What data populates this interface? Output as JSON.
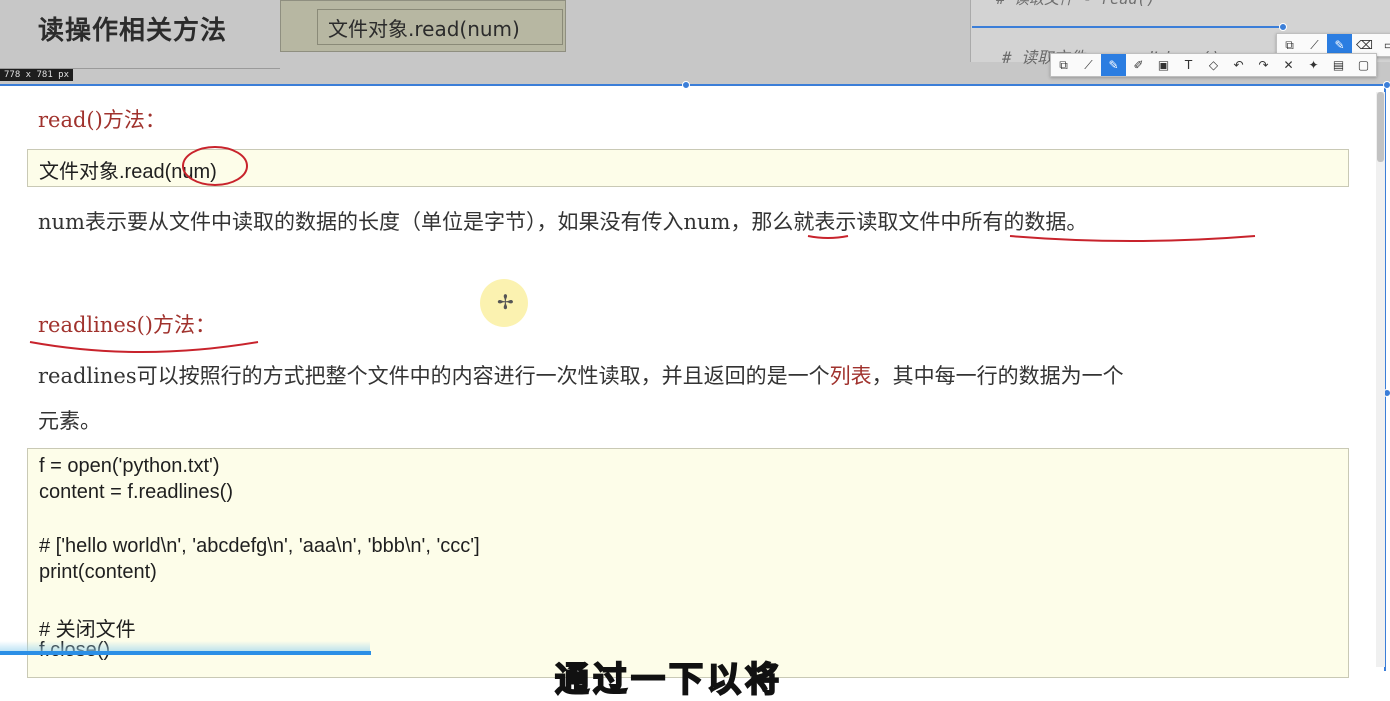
{
  "header": {
    "title": "读操作相关方法",
    "code_chip": "文件对象.read(num)",
    "dimension_label": "778 x 781  px"
  },
  "background_editor": {
    "top_line": "# 读取文件 - read()",
    "comment_line": "# 读取文件 - readLines()"
  },
  "toolbar_main": {
    "icons": [
      "screenshot-icon",
      "trend-icon",
      "pen-icon",
      "eraser-icon",
      "window-icon"
    ]
  },
  "toolbar_secondary": {
    "icons": [
      "copy-icon",
      "trend-icon",
      "pen-icon",
      "marker-icon",
      "fill-icon",
      "text-icon",
      "eraser-icon",
      "undo-icon",
      "redo-icon",
      "close-icon",
      "pin-icon",
      "save-icon",
      "clipboard-icon"
    ]
  },
  "doc": {
    "read_title": "read()方法：",
    "read_code": "文件对象.read(num)",
    "read_desc_part1": "num表示要从文件中读取的数据的长度（单位是字节），如果没有传入num，那么就表示读取文件中所有的数据。",
    "readlines_title": "readlines()方法：",
    "readlines_desc_pre": "readlines可以按照行的方式把整个文件中的内容进行一次性读取，并且返回的是一个",
    "readlines_desc_hl": "列表",
    "readlines_desc_post": "，其中每一行的数据为一个",
    "readlines_desc_line2": "元素。",
    "code_lines": [
      "f = open('python.txt')",
      "content = f.readlines()",
      "",
      "# ['hello world\\n', 'abcdefg\\n', 'aaa\\n', 'bbb\\n', 'ccc']",
      "print(content)",
      "",
      "# 关闭文件",
      "f.close()"
    ]
  },
  "colors": {
    "accent": "#a0322d",
    "selection": "#3b7ed8",
    "code_bg": "#fdfde9"
  },
  "video": {
    "progress_fraction": 0.267,
    "subtitle_fragment": "通过一下以将"
  }
}
